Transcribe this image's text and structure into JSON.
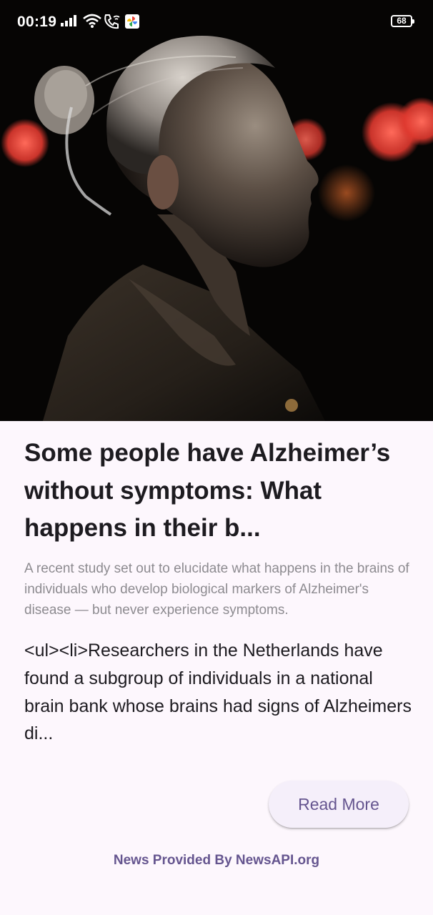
{
  "status_bar": {
    "time": "00:19",
    "battery": "68",
    "icons": [
      "signal-icon",
      "wifi-icon",
      "wifi-calling-icon",
      "google-photos-icon",
      "battery-icon"
    ]
  },
  "article": {
    "image_alt": "Elderly woman in profile against dark background with red bokeh lights",
    "title": "Some people have Alzheimer’s without symptoms: What happens in their b...",
    "description": "A recent study set out to elucidate what happens in the brains of individuals who develop biological markers of Alzheimer's disease — but never experience symptoms.",
    "content": "<ul><li>Researchers in the Netherlands have found a subgroup of individuals in a national brain bank whose brains had signs of Alzheimers di..."
  },
  "actions": {
    "read_more_label": "Read More"
  },
  "footer": {
    "credit": "News Provided By NewsAPI.org"
  },
  "colors": {
    "background": "#fdf7fd",
    "title": "#1d1b20",
    "description": "#8d8b90",
    "accent": "#65558f",
    "button_bg": "#f5effa"
  }
}
